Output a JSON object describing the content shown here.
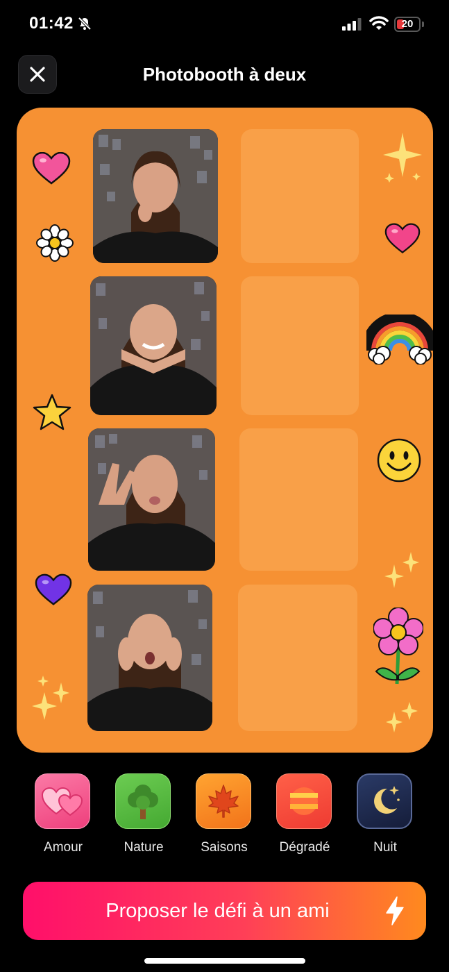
{
  "status_bar": {
    "time": "01:42",
    "battery": "20"
  },
  "header": {
    "title": "Photobooth à deux"
  },
  "booth": {
    "photos": [
      {
        "pose": "pensive, finger on chin"
      },
      {
        "pose": "winking, chin on hands"
      },
      {
        "pose": "peace sign, kissy face"
      },
      {
        "pose": "surprised, hands on cheeks"
      }
    ],
    "empty_slots": 4
  },
  "themes": [
    {
      "label": "Amour",
      "icon": "two-hearts-icon",
      "color": "#f4588b"
    },
    {
      "label": "Nature",
      "icon": "tree-icon",
      "color": "#55b941"
    },
    {
      "label": "Saisons",
      "icon": "maple-leaf-icon",
      "color": "#f48b1a"
    },
    {
      "label": "Dégradé",
      "icon": "gradient-stripes-icon",
      "color": "#f5533a"
    },
    {
      "label": "Nuit",
      "icon": "moon-stars-icon",
      "color": "#1d2a4f"
    }
  ],
  "cta": {
    "label": "Proposer le défi à un ami"
  },
  "colors": {
    "frame": "#f69133",
    "slot": "#f9a048",
    "accent_start": "#ff0f6a",
    "accent_end": "#ff8a1e"
  }
}
